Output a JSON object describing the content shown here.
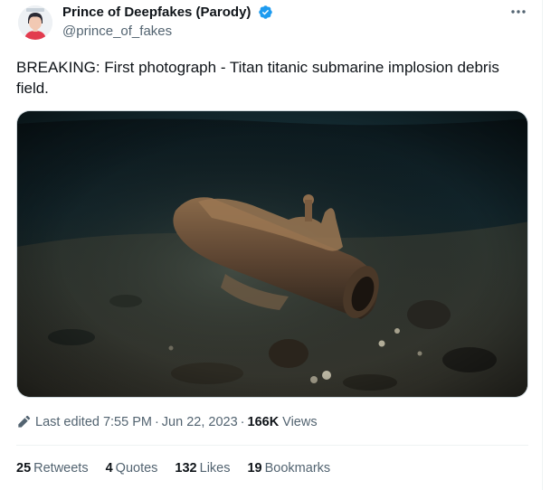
{
  "author": {
    "display_name": "Prince of Deepfakes (Parody)",
    "handle": "@prince_of_fakes"
  },
  "icons": {
    "verified": "verified-badge-icon",
    "more": "more-options-icon",
    "edited": "pencil-icon"
  },
  "tweet": {
    "text": "BREAKING: First photograph - Titan titanic submarine implosion debris field."
  },
  "meta": {
    "edited_label": "Last edited",
    "time": "7:55 PM",
    "separator": "·",
    "date": "Jun 22, 2023",
    "views_count": "166K",
    "views_label": "Views"
  },
  "stats": [
    {
      "count": "25",
      "label": "Retweets"
    },
    {
      "count": "4",
      "label": "Quotes"
    },
    {
      "count": "132",
      "label": "Likes"
    },
    {
      "count": "19",
      "label": "Bookmarks"
    }
  ],
  "colors": {
    "text": "#0f1419",
    "secondary": "#536471",
    "verified": "#1d9bf0",
    "divider": "#eff3f4"
  }
}
